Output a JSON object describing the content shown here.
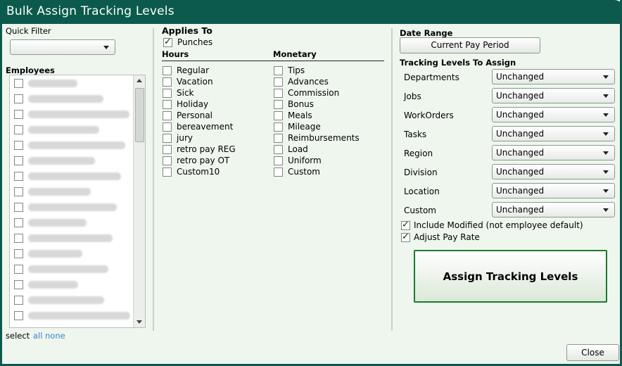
{
  "window": {
    "title": "Bulk Assign Tracking Levels"
  },
  "quick_filter": {
    "label": "Quick Filter",
    "value": ""
  },
  "employees": {
    "label": "Employees",
    "count": 16,
    "select_label": "select",
    "all_label": "all",
    "none_label": "none"
  },
  "applies_to": {
    "label": "Applies To",
    "punches_label": "Punches",
    "punches_checked": true,
    "hours_header": "Hours",
    "monetary_header": "Monetary",
    "hours": [
      "Regular",
      "Vacation",
      "Sick",
      "Holiday",
      "Personal",
      "bereavement",
      "jury",
      "retro pay REG",
      "retro pay OT",
      "Custom10"
    ],
    "monetary": [
      "Tips",
      "Advances",
      "Commission",
      "Bonus",
      "Meals",
      "Mileage",
      "Reimbursements",
      "Load",
      "Uniform",
      "Custom"
    ]
  },
  "date_range": {
    "label": "Date Range",
    "button_label": "Current Pay Period"
  },
  "tracking": {
    "header": "Tracking Levels To Assign",
    "levels": [
      {
        "label": "Departments",
        "value": "Unchanged"
      },
      {
        "label": "Jobs",
        "value": "Unchanged"
      },
      {
        "label": "WorkOrders",
        "value": "Unchanged"
      },
      {
        "label": "Tasks",
        "value": "Unchanged"
      },
      {
        "label": "Region",
        "value": "Unchanged"
      },
      {
        "label": "Division",
        "value": "Unchanged"
      },
      {
        "label": "Location",
        "value": "Unchanged"
      },
      {
        "label": "Custom",
        "value": "Unchanged"
      }
    ],
    "include_modified_label": "Include Modified (not employee default)",
    "include_modified_checked": true,
    "adjust_pay_rate_label": "Adjust Pay Rate",
    "adjust_pay_rate_checked": true
  },
  "assign_button": "Assign Tracking Levels",
  "close_button": "Close",
  "colors": {
    "titlebar": "#0b5a4d",
    "background": "#eef6ee",
    "accent_border": "#1e7a2e",
    "link": "#3a86c8"
  }
}
